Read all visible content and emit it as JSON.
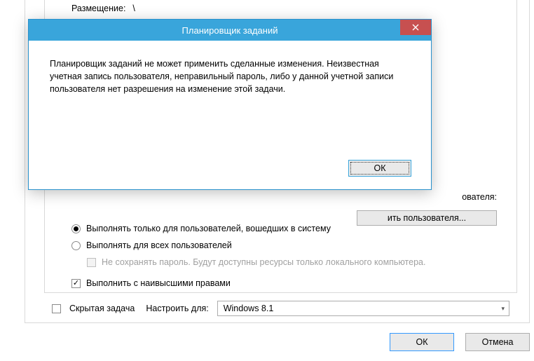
{
  "bg": {
    "placement_label": "Размещение:",
    "placement_value": "\\",
    "user_suffix_label": "ователя:",
    "change_user_btn": "ить пользователя...",
    "radio_logged_in": "Выполнять только для пользователей, вошедших в систему",
    "radio_all_users": "Выполнять для всех пользователей",
    "no_store_pw": "Не сохранять пароль. Будут доступны ресурсы только локального компьютера.",
    "run_highest": "Выполнить с наивысшими правами",
    "hidden_task": "Скрытая задача",
    "configure_for": "Настроить для:",
    "select_value": "Windows 8.1",
    "ok": "ОК",
    "cancel": "Отмена"
  },
  "modal": {
    "title": "Планировщик заданий",
    "body": "Планировщик заданий не может применить сделанные изменения. Неизвестная учетная запись пользователя, неправильный пароль, либо у данной учетной записи пользователя нет разрешения на изменение этой задачи.",
    "ok": "ОК"
  }
}
